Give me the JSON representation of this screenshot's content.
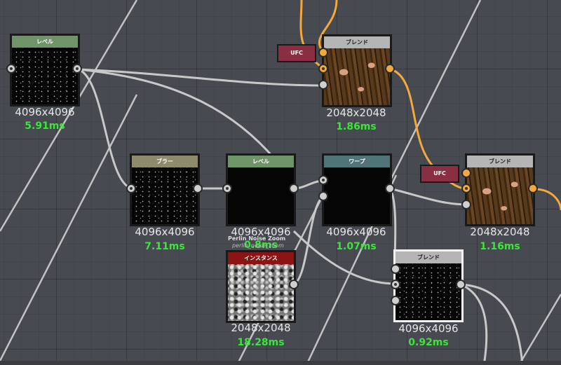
{
  "nodes": {
    "level1": {
      "title": "レベル",
      "size": "4096x4096",
      "time": "5.91ms"
    },
    "blend1": {
      "title": "ブレンド",
      "size": "2048x2048",
      "time": "1.86ms"
    },
    "blur": {
      "title": "ブラー",
      "size": "4096x4096",
      "time": "7.11ms"
    },
    "level2": {
      "title": "レベル",
      "size": "4096x4096",
      "time": "0.8ms"
    },
    "warp": {
      "title": "ワープ",
      "size": "4096x4096",
      "time": "1.07ms"
    },
    "blend2": {
      "title": "ブレンド",
      "size": "2048x2048",
      "time": "1.16ms"
    },
    "instance": {
      "title": "インスタンス",
      "size": "2048x2048",
      "time": "18.28ms",
      "label": "Perlin Noise Zoom",
      "sublabel": "perlin_noise_zoom"
    },
    "blend3": {
      "title": "ブレンド",
      "size": "4096x4096",
      "time": "0.92ms"
    }
  },
  "ufc1": "UFC",
  "ufc2": "UFC",
  "colors": {
    "bg": "#474a50",
    "wire": "#c8c8c8",
    "wire_orange": "#f3a93e",
    "time_green": "#39e639"
  }
}
